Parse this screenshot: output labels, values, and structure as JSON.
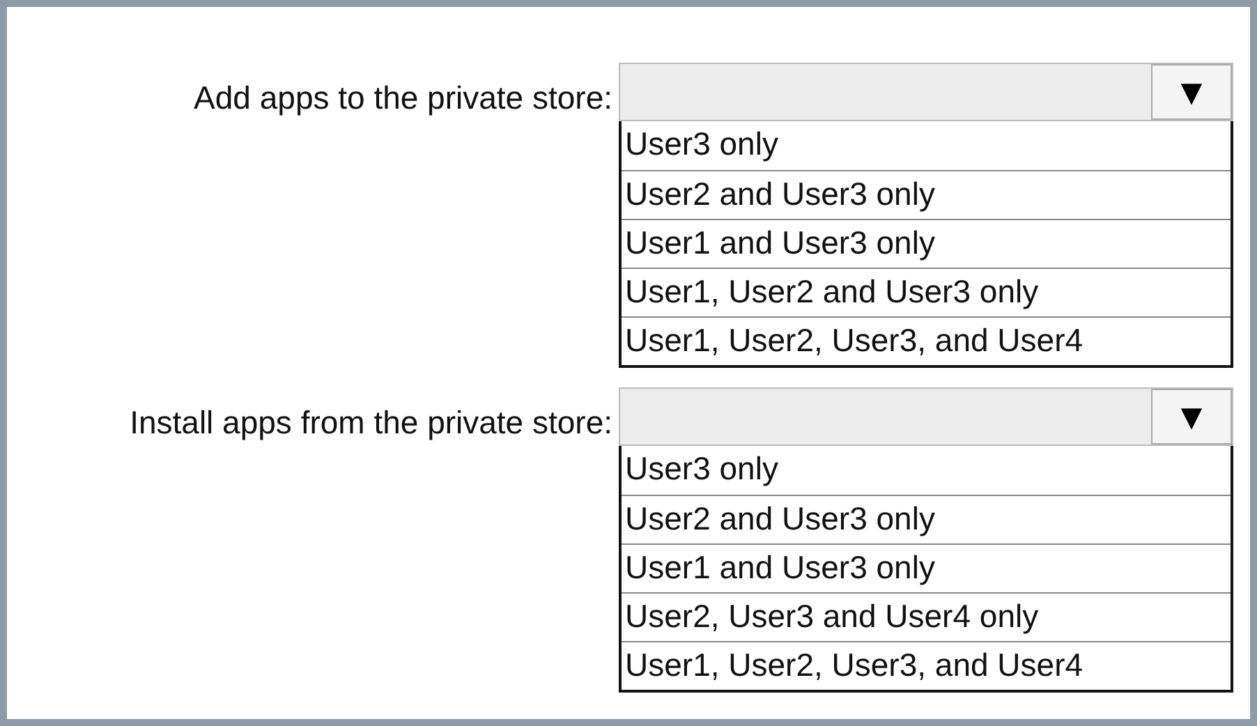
{
  "questions": [
    {
      "label": "Add apps to the private store:",
      "arrow": "▼",
      "options": [
        "User3 only",
        "User2 and User3 only",
        "User1 and User3 only",
        "User1, User2 and User3 only",
        "User1, User2, User3, and User4"
      ]
    },
    {
      "label": "Install apps from the private store:",
      "arrow": "▼",
      "options": [
        "User3 only",
        "User2 and User3 only",
        "User1 and User3 only",
        "User2, User3 and User4 only",
        "User1, User2, User3, and User4"
      ]
    }
  ]
}
